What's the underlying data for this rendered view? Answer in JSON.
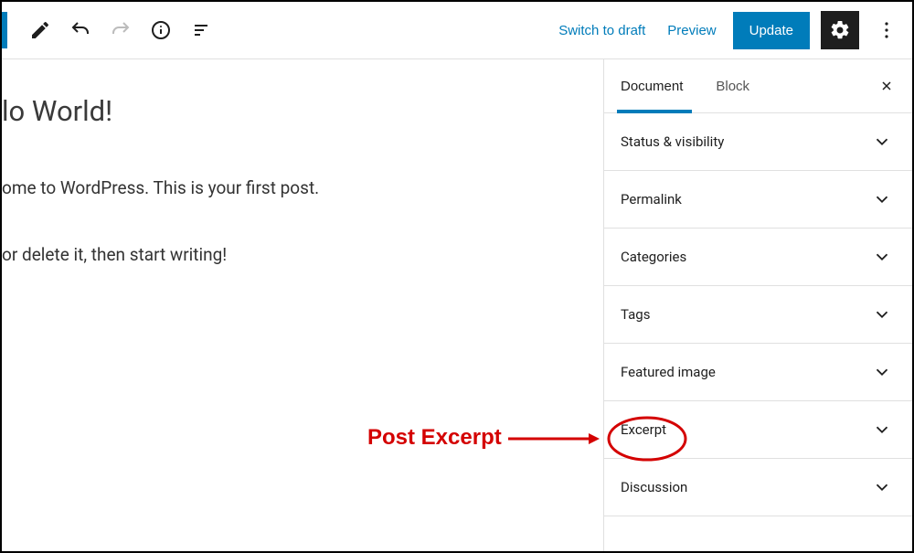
{
  "toolbar": {
    "switch_to_draft": "Switch to draft",
    "preview": "Preview",
    "update": "Update"
  },
  "editor": {
    "title": "lo World!",
    "para1": "ome to WordPress. This is your first post.",
    "para2": "or delete it, then start writing!"
  },
  "sidebar": {
    "tabs": {
      "document": "Document",
      "block": "Block"
    },
    "panels": [
      "Status & visibility",
      "Permalink",
      "Categories",
      "Tags",
      "Featured image",
      "Excerpt",
      "Discussion"
    ]
  },
  "annotation": {
    "label": "Post Excerpt"
  }
}
